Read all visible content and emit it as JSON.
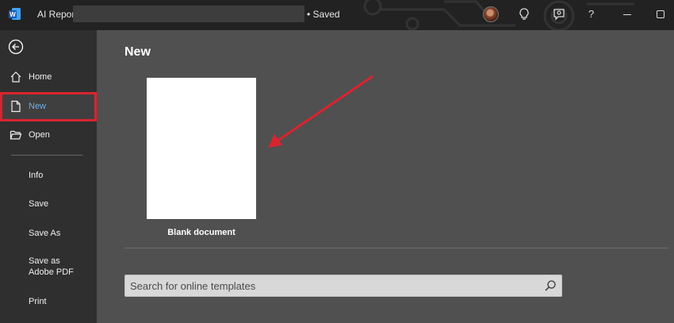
{
  "titlebar": {
    "app_icon": "word-logo",
    "doc_title": "AI Report",
    "status": "• Saved",
    "icons": [
      "avatar",
      "lightbulb-icon",
      "coauthor-comment-icon",
      "help-icon",
      "minimize-icon",
      "maximize-icon"
    ],
    "help_label": "?"
  },
  "sidebar": {
    "back_icon": "back-arrow-icon",
    "items": [
      {
        "label": "Home",
        "icon": "home-icon"
      },
      {
        "label": "New",
        "icon": "new-document-icon",
        "active": true
      },
      {
        "label": "Open",
        "icon": "open-folder-icon"
      }
    ],
    "sub_items": [
      {
        "label": "Info"
      },
      {
        "label": "Save"
      },
      {
        "label": "Save As"
      },
      {
        "label": "Save as\nAdobe PDF"
      },
      {
        "label": "Print"
      }
    ]
  },
  "main": {
    "heading": "New",
    "templates": [
      {
        "label": "Blank document"
      }
    ],
    "search": {
      "placeholder": "Search for online templates",
      "value": "",
      "icon": "search-icon"
    }
  },
  "annotation": {
    "type": "red-arrow",
    "color": "#d9242f",
    "highlight_color": "#d9242f"
  }
}
